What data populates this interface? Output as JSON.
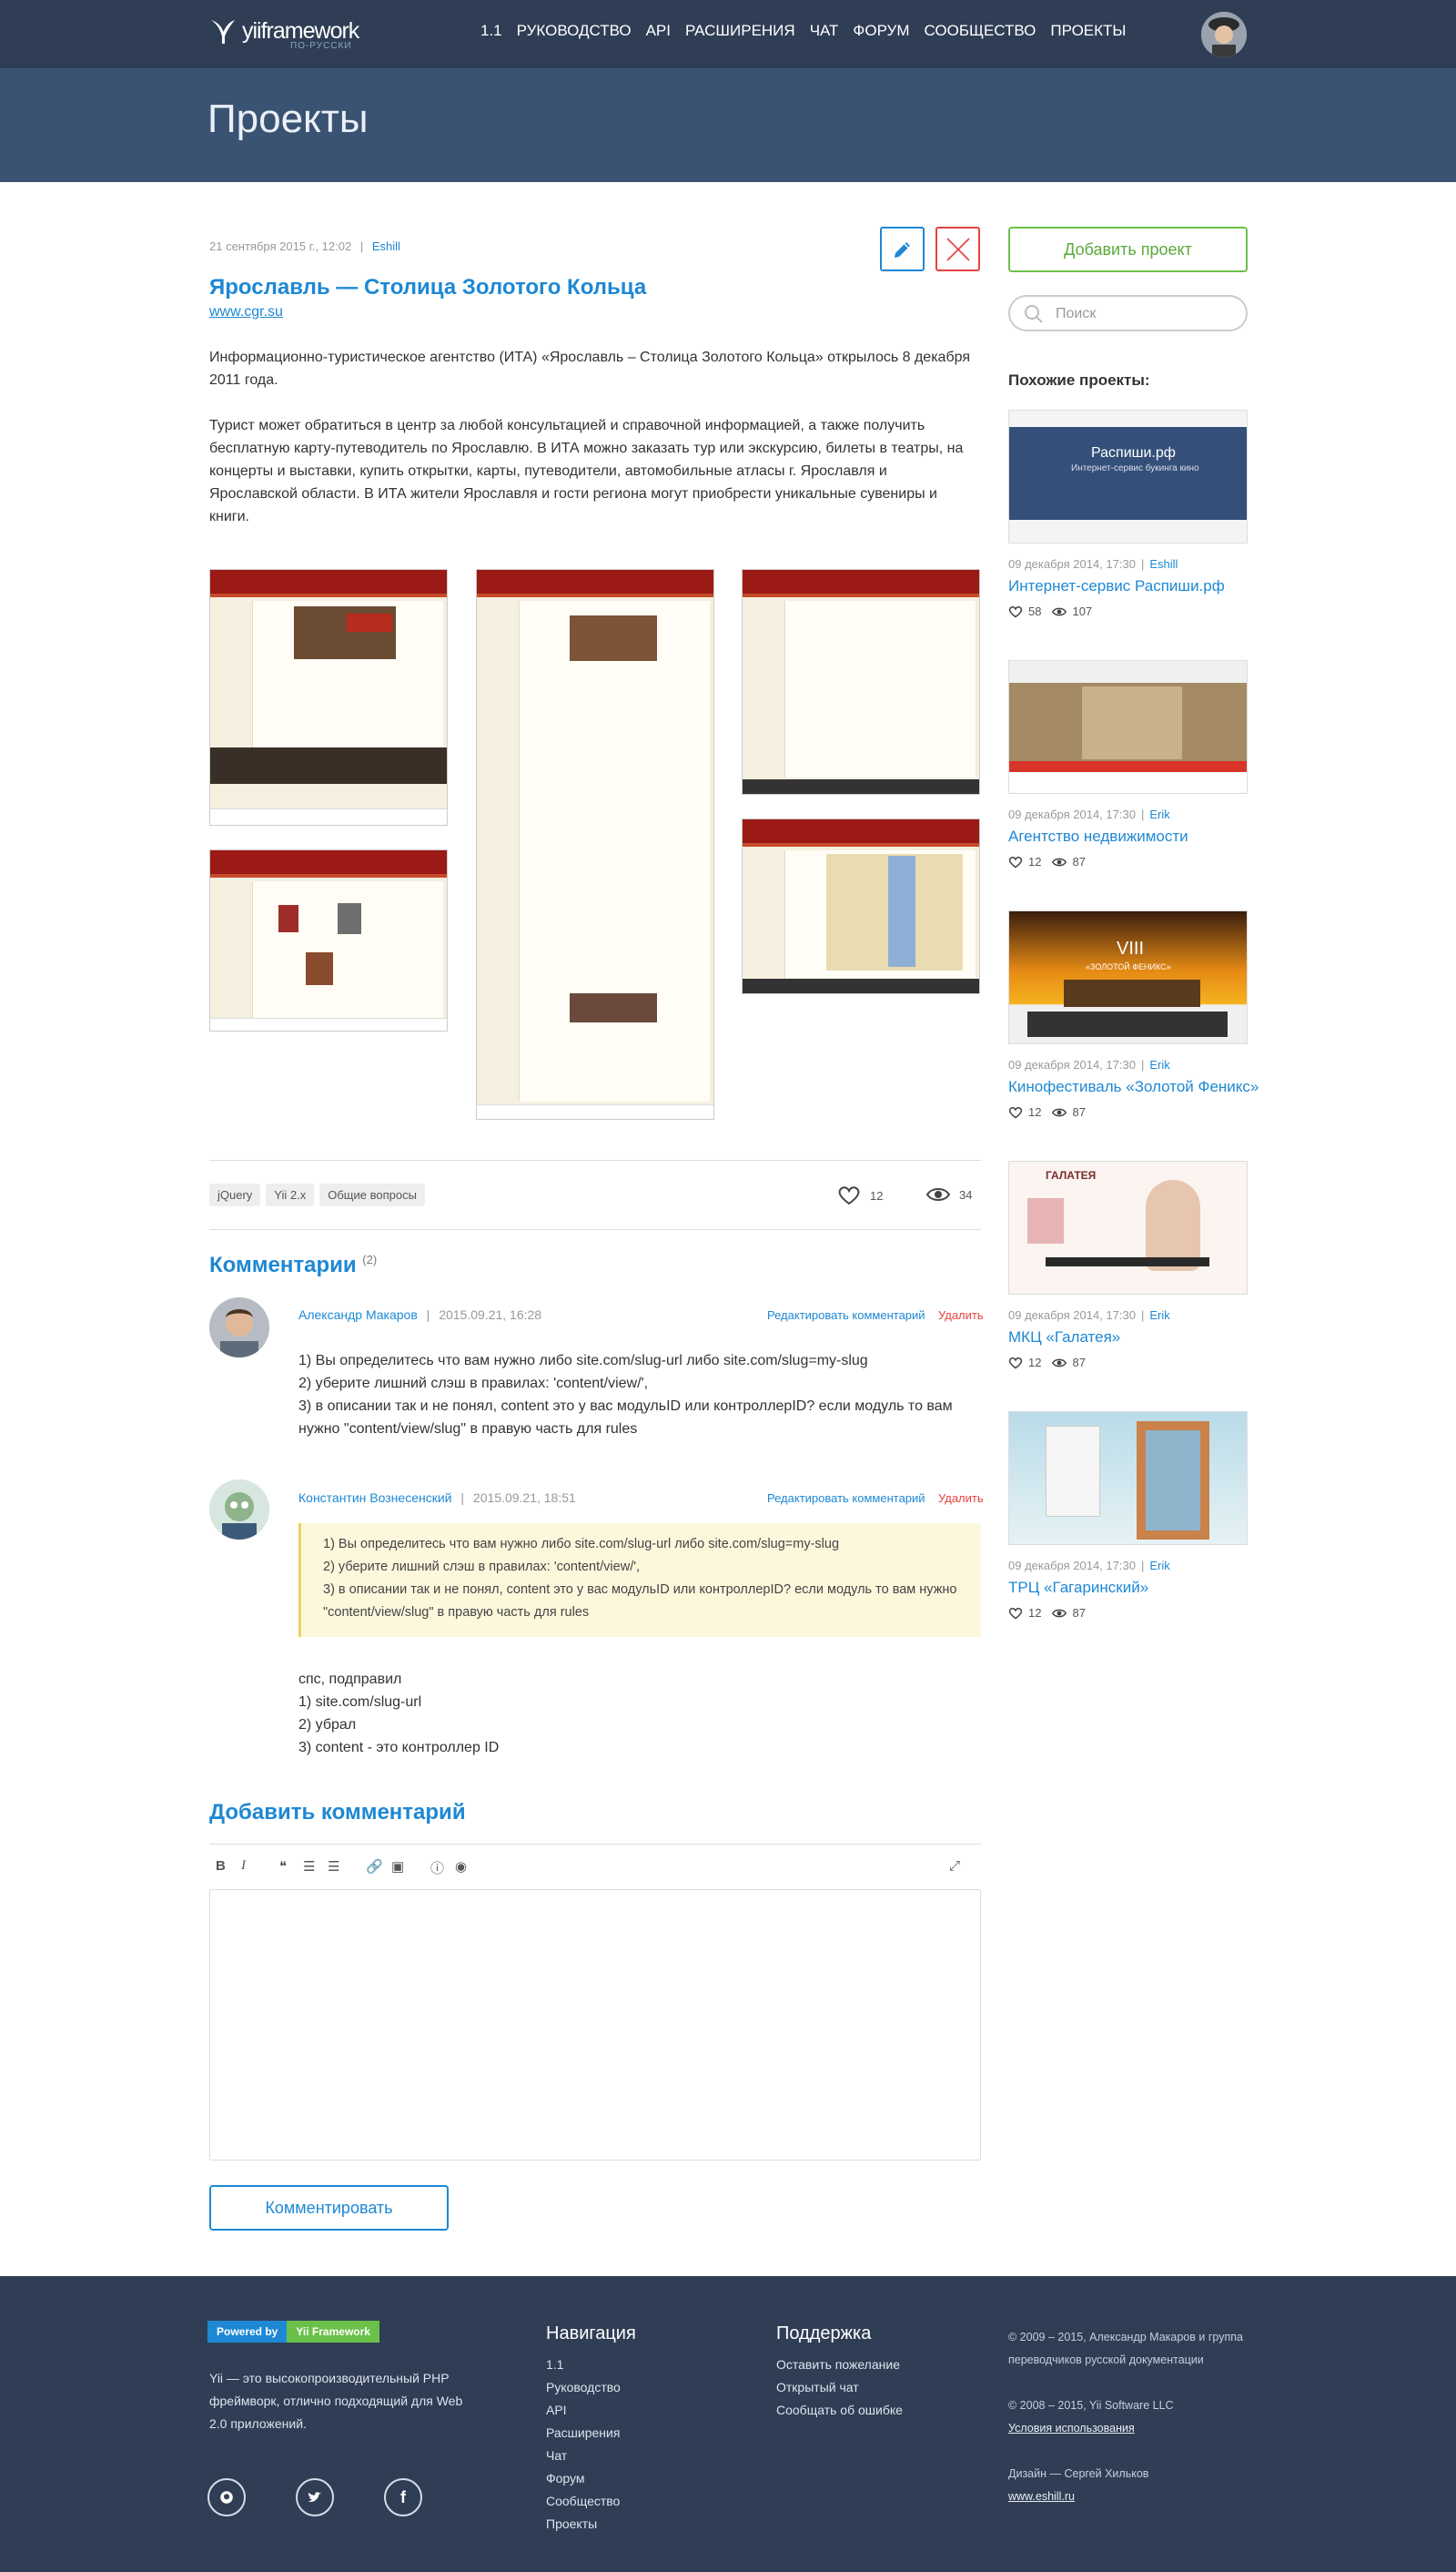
{
  "header": {
    "logo_word": "yiiframework",
    "logo_sub": "ПО-РУССКИ",
    "nav": [
      "1.1",
      "РУКОВОДСТВО",
      "API",
      "РАСШИРЕНИЯ",
      "ЧАТ",
      "ФОРУМ",
      "СООБЩЕСТВО",
      "ПРОЕКТЫ"
    ]
  },
  "banner": {
    "title": "Проекты"
  },
  "project": {
    "date": "21 сентября 2015 г., 12:02",
    "sep": "|",
    "author": "Eshill",
    "title": "Ярославль — Столица Золотого Кольца",
    "url": "www.cgr.su",
    "paragraphs": [
      "Информационно-туристическое агентство (ИТА) «Ярославль – Столица Золотого Кольца» открылось 8 декабря 2011 года.",
      "Турист может обратиться в центр за любой консультацией и справочной информацией, а также получить бесплатную карту-путеводитель по Ярославлю. В ИТА можно заказать тур или экскурсию, билеты в театры, на концерты и выставки, купить открытки, карты, путеводители, автомобильные атласы г. Ярославля и Ярославской области. В ИТА жители Ярославля и гости региона могут приобрести уникальные сувениры и книги."
    ],
    "tags": [
      "jQuery",
      "Yii 2.x",
      "Общие вопросы"
    ],
    "likes": "12",
    "views": "34"
  },
  "comments": {
    "heading": "Комментарии",
    "count": "(2)",
    "edit_label": "Редактировать комментарий",
    "delete_label": "Удалить",
    "items": [
      {
        "author": "Александр Макаров",
        "date": "2015.09.21, 16:28",
        "lines": [
          "1) Вы определитесь что вам нужно либо site.com/slug-url либо site.com/slug=my-slug",
          "2) уберите лишний слэш в правилах: 'content/view/',",
          "3) в описании так и не понял, content это у вас модульID или контроллерID? если модуль то вам нужно \"content/view/slug\" в правую часть для rules"
        ]
      },
      {
        "author": "Константин Вознесенский",
        "date": "2015.09.21, 18:51",
        "quote": [
          "1) Вы определитесь что вам нужно либо site.com/slug-url либо site.com/slug=my-slug",
          "2) уберите лишний слэш в правилах: 'content/view/',",
          "3) в описании так и не понял, content это у вас модульID или контроллерID? если модуль то вам нужно \"content/view/slug\" в правую часть для rules"
        ],
        "lines": [
          "спс, подправил",
          "1) site.com/slug-url",
          "2) убрал",
          "3) content - это контроллер ID"
        ]
      }
    ]
  },
  "add_comment": {
    "heading": "Добавить комментарий",
    "submit": "Комментировать"
  },
  "sidebar": {
    "add_project": "Добавить проект",
    "search_placeholder": "Поиск",
    "similar_heading": "Похожие проекты:",
    "thumb_text": {
      "title": "Распиши.рф",
      "subtitle": "Интернет-сервис букинга кино",
      "fest_title": "VIII",
      "fest_subtitle": "«ЗОЛОТОЙ ФЕНИКС»",
      "mkc_brand": "ГАЛАТЕЯ"
    },
    "projects": [
      {
        "date": "09 декабря 2014, 17:30",
        "author": "Eshill",
        "title": "Интернет-сервис Распиши.рф",
        "likes": "58",
        "views": "107"
      },
      {
        "date": "09 декабря 2014, 17:30",
        "author": "Erik",
        "title": "Агентство недвижимости",
        "likes": "12",
        "views": "87"
      },
      {
        "date": "09 декабря 2014, 17:30",
        "author": "Erik",
        "title": "Кинофестиваль «Золотой Феникс»",
        "likes": "12",
        "views": "87"
      },
      {
        "date": "09 декабря 2014, 17:30",
        "author": "Erik",
        "title": "МКЦ «Галатея»",
        "likes": "12",
        "views": "87"
      },
      {
        "date": "09 декабря 2014, 17:30",
        "author": "Erik",
        "title": "ТРЦ «Гагаринский»",
        "likes": "12",
        "views": "87"
      }
    ]
  },
  "footer": {
    "powered_a": "Powered by",
    "powered_b": "Yii Framework",
    "desc": "Yii — это высокопроизводительный PHP фреймворк, отлично подходящий для Web 2.0 приложений.",
    "nav_heading": "Навигация",
    "nav": [
      "1.1",
      "Руководство",
      "API",
      "Расширения",
      "Чат",
      "Форум",
      "Сообщество",
      "Проекты"
    ],
    "support_heading": "Поддержка",
    "support": [
      "Оставить пожелание",
      "Открытый чат",
      "Сообщать об ошибке"
    ],
    "copy1": "© 2009 – 2015, Александр Макаров и группа переводчиков русской документации",
    "copy2": "© 2008 – 2015, Yii Software LLC",
    "terms": "Условия использования",
    "design": "Дизайн — Сергей Хильков",
    "design_url": "www.eshill.ru"
  }
}
